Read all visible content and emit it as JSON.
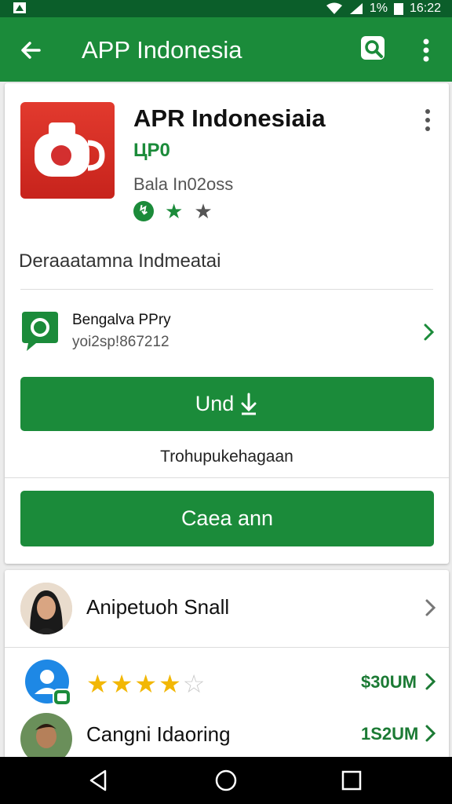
{
  "status_bar": {
    "battery": "1%",
    "time": "16:22",
    "icons": [
      "notification-icon",
      "wifi-icon",
      "signal-icon",
      "battery-icon"
    ]
  },
  "app_bar": {
    "title": "APP Indonesia",
    "icons": [
      "back-arrow-icon",
      "search-icon",
      "more-vert-icon"
    ]
  },
  "app": {
    "name": "APR Indonesiaia",
    "price": "ЦP0",
    "developer": "Bala In02oss",
    "description": "Deraaatamna Indmeatai",
    "icon": "camera-icon"
  },
  "permission": {
    "title": "Bengalva PPry",
    "subtitle": "yoi2sp!867212",
    "icon": "chat-bubble-icon"
  },
  "buttons": {
    "install_label": "Und",
    "install_icon": "download-icon",
    "caption": "Trohupukehagaan",
    "cancel_label": "Caea ann"
  },
  "list": [
    {
      "label": "Anipetuoh Snall",
      "icon": "avatar-woman"
    },
    {
      "rating": 4,
      "price": "$30UM",
      "icon": "contact-badge-icon"
    },
    {
      "label": "Cangni Idaoring",
      "price": "1S2UM",
      "icon": "avatar-man"
    }
  ],
  "colors": {
    "status_bar": "#0b5e2a",
    "primary": "#1b8b3a",
    "app_icon": "#d32f2f",
    "star": "#f2b705"
  }
}
